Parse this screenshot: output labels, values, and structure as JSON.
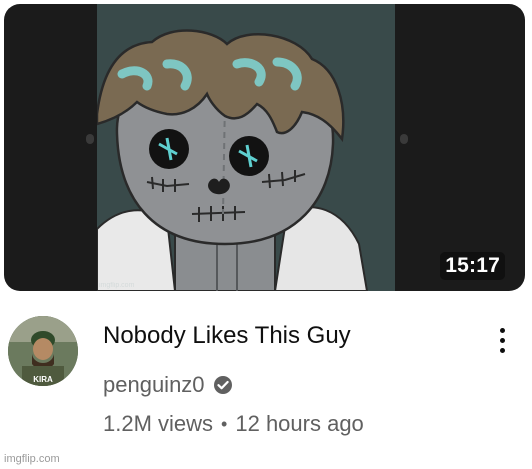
{
  "video": {
    "duration": "15:17",
    "thumbnail_label": "imgflip.com"
  },
  "title": "Nobody Likes This Guy",
  "channel": {
    "name": "penguinz0",
    "verified": true,
    "avatar_text": "KIRA"
  },
  "meta": {
    "views": "1.2M views",
    "separator": "•",
    "age": "12 hours ago"
  },
  "icons": {
    "verified": "check-circle-icon",
    "more": "vertical-ellipsis-icon"
  },
  "watermark": "imgflip.com",
  "colors": {
    "thumbnail_bg": "#1b1b1b",
    "art_bg": "#394a4a",
    "title": "#0f0f0f",
    "secondary_text": "#606060"
  }
}
